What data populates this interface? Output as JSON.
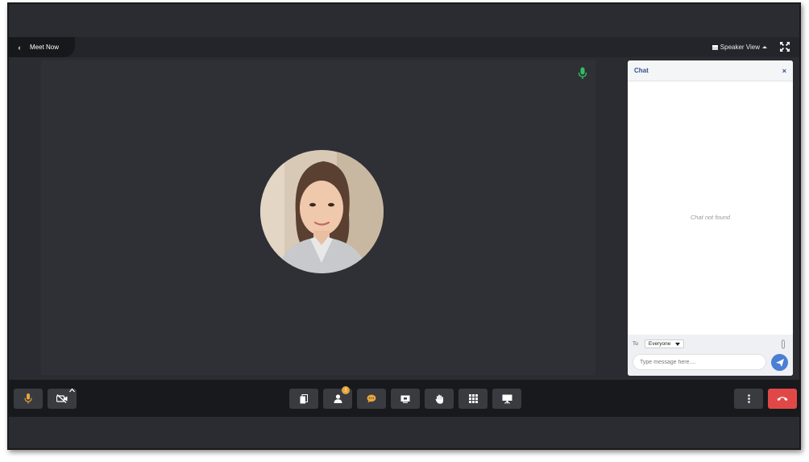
{
  "header": {
    "back_label": "Meet Now",
    "view_label": "Speaker View"
  },
  "chat": {
    "title": "Chat",
    "close_glyph": "×",
    "empty_text": "Chat not found",
    "to_label": "To",
    "to_value": "Everyone",
    "message_placeholder": "Type message here...."
  },
  "toolbar": {
    "participants_badge": "!"
  },
  "colors": {
    "mic_active": "#e8a63b",
    "speaking_indicator": "#2fbf5f",
    "end_call": "#e04848",
    "accent": "#4a7fd3"
  },
  "icons": [
    "chevron-left-icon",
    "layout-icon",
    "caret-up-icon",
    "expand-icon",
    "microphone-icon",
    "video-off-icon",
    "copy-icon",
    "participants-icon",
    "chat-icon",
    "screen-share-icon",
    "raise-hand-icon",
    "grid-icon",
    "whiteboard-icon",
    "more-icon",
    "end-call-icon",
    "attachment-icon",
    "send-icon"
  ]
}
